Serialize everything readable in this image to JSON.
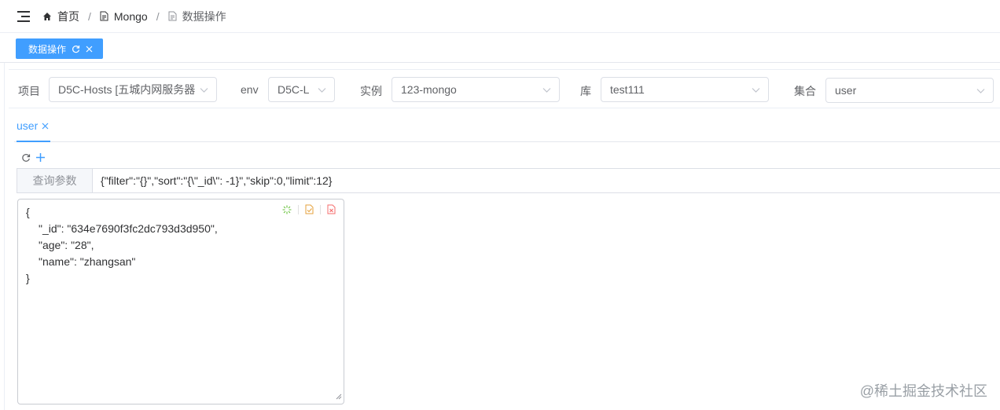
{
  "breadcrumb": {
    "home": "首页",
    "mongo": "Mongo",
    "current": "数据操作",
    "separator": "/"
  },
  "tags": [
    {
      "label": "数据操作",
      "active": true
    }
  ],
  "filters": {
    "project": {
      "label": "项目",
      "value": "D5C-Hosts [五城内网服务器"
    },
    "env": {
      "label": "env",
      "value": "D5C-L"
    },
    "instance": {
      "label": "实例",
      "value": "123-mongo"
    },
    "database": {
      "label": "库",
      "value": "test111"
    },
    "collection": {
      "label": "集合",
      "value": "user"
    }
  },
  "tabs": [
    {
      "label": "user",
      "active": true
    }
  ],
  "query": {
    "label": "查询参数",
    "value": "{\"filter\":\"{}\",\"sort\":\"{\\\"_id\\\": -1}\",\"skip\":0,\"limit\":12}"
  },
  "document": {
    "open": "{",
    "lines": [
      "\"_id\": \"634e7690f3fc2dc793d3d950\",",
      "\"age\": \"28\",",
      "\"name\": \"zhangsan\""
    ],
    "close": "}"
  },
  "watermark": "@稀土掘金技术社区",
  "colors": {
    "primary": "#409eff",
    "border": "#dcdfe6",
    "format_icon": "#67c23a",
    "save_icon": "#e6a23c",
    "delete_icon": "#f56c6c"
  }
}
